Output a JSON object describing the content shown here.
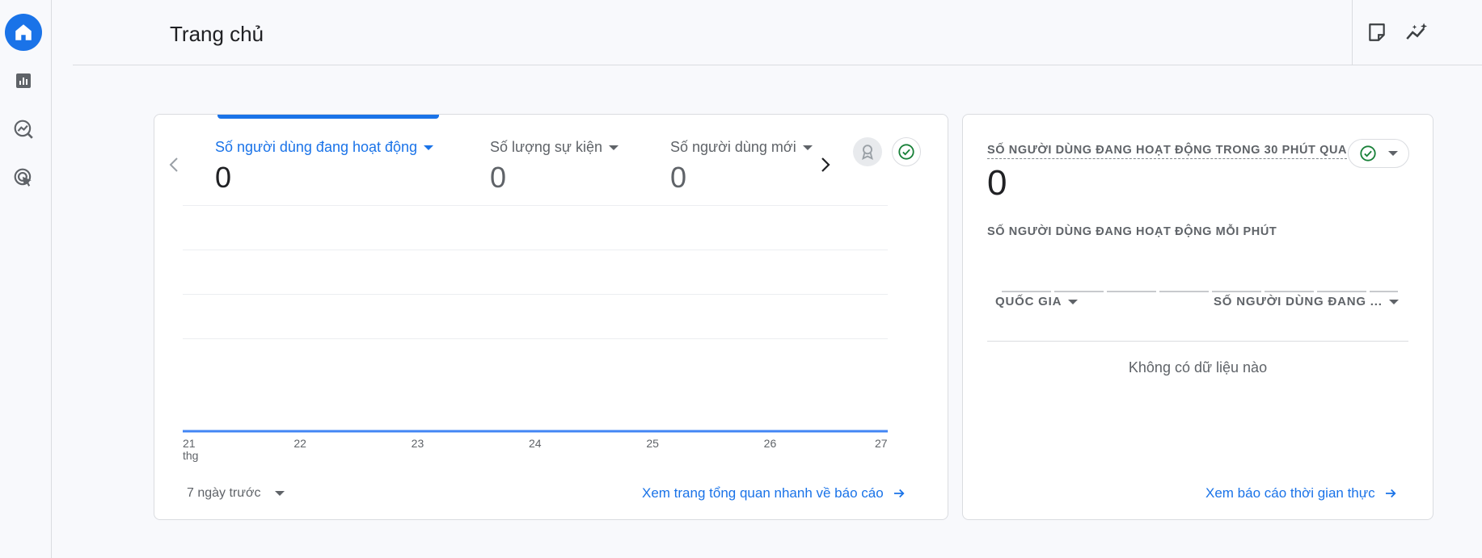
{
  "header": {
    "title": "Trang chủ"
  },
  "rail": {
    "items": [
      {
        "icon": "home-icon"
      },
      {
        "icon": "reports-icon"
      },
      {
        "icon": "explore-icon"
      },
      {
        "icon": "advertising-icon"
      }
    ]
  },
  "colors": {
    "accent": "#1a73e8",
    "success": "#188038"
  },
  "overview": {
    "metrics": [
      {
        "label": "Số người dùng đang hoạt động",
        "value": "0"
      },
      {
        "label": "Số lượng sự kiện",
        "value": "0"
      },
      {
        "label": "Số người dùng mới",
        "value": "0"
      }
    ],
    "date_range": "7 ngày trước",
    "link": "Xem trang tổng quan nhanh về báo cáo"
  },
  "chart_data": {
    "type": "line",
    "x": [
      "21 thg",
      "22",
      "23",
      "24",
      "25",
      "26",
      "27"
    ],
    "series": [
      {
        "values": [
          0,
          0,
          0,
          0,
          0,
          0,
          0
        ]
      }
    ],
    "grid": true
  },
  "realtime": {
    "title": "SỐ NGƯỜI DÙNG ĐANG HOẠT ĐỘNG TRONG 30 PHÚT QUA",
    "value": "0",
    "subtitle": "SỐ NGƯỜI DÙNG ĐANG HOẠT ĐỘNG MỖI PHÚT",
    "columns": [
      "QUỐC GIA",
      "SỐ NGƯỜI DÙNG ĐANG ..."
    ],
    "empty": "Không có dữ liệu nào",
    "link": "Xem báo cáo thời gian thực"
  }
}
